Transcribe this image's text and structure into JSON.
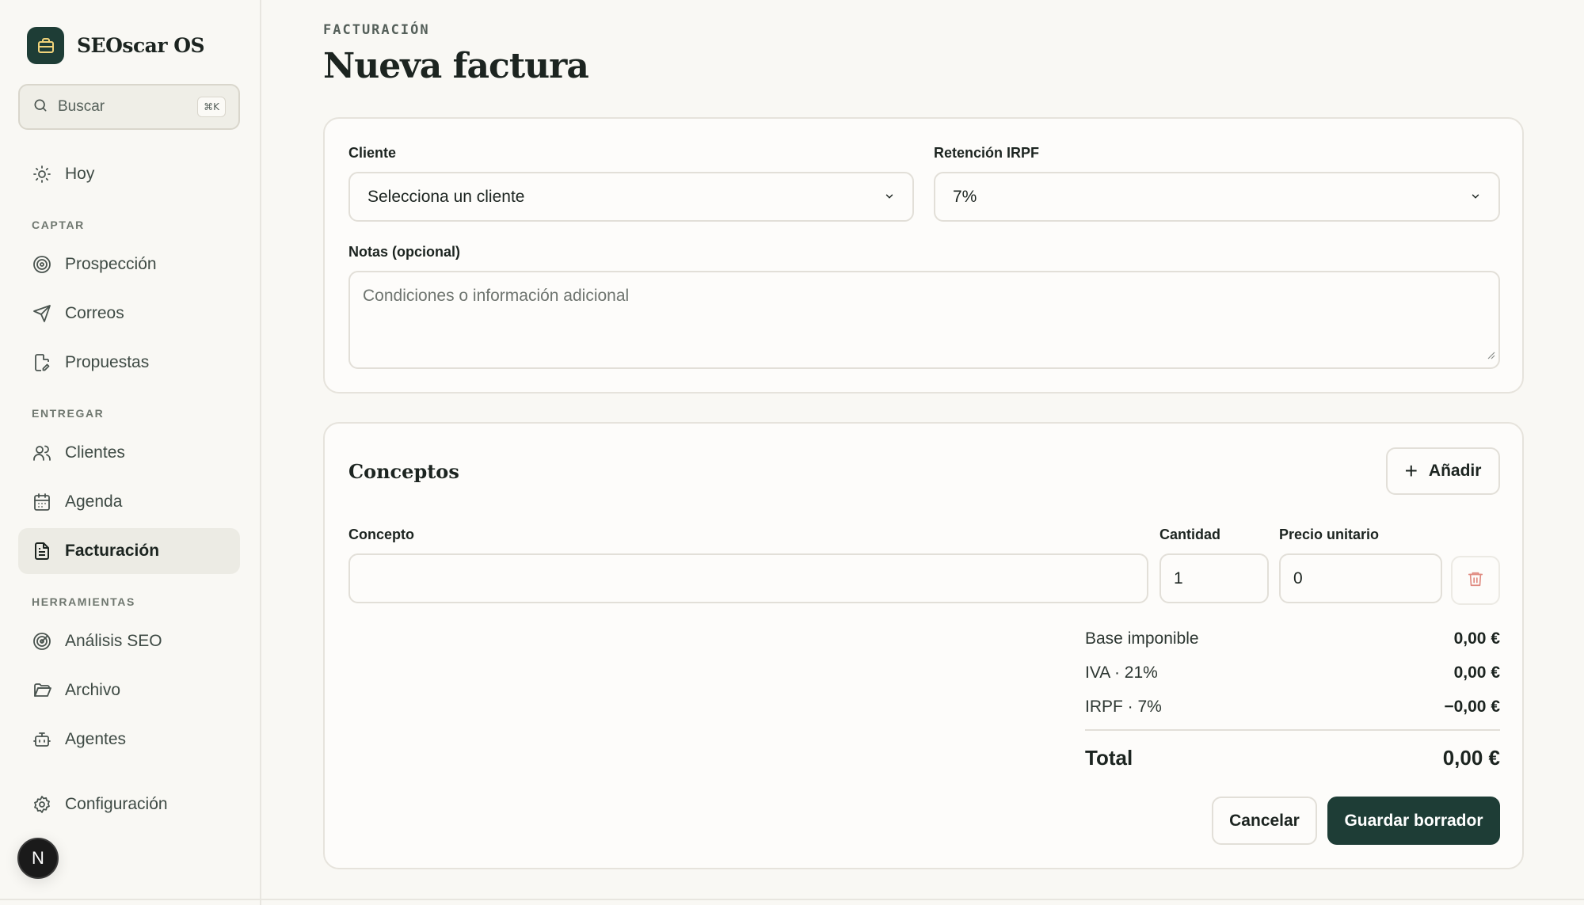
{
  "sidebar": {
    "brand": "SEOscar OS",
    "search_placeholder": "Buscar",
    "search_shortcut": "⌘K",
    "items": [
      {
        "label": "Hoy",
        "icon": "sun-icon"
      },
      {
        "label": "Prospección",
        "icon": "target-icon"
      },
      {
        "label": "Correos",
        "icon": "send-icon"
      },
      {
        "label": "Propuestas",
        "icon": "document-edit-icon"
      },
      {
        "label": "Clientes",
        "icon": "users-icon"
      },
      {
        "label": "Agenda",
        "icon": "calendar-icon"
      },
      {
        "label": "Facturación",
        "icon": "file-text-icon",
        "active": true
      },
      {
        "label": "Análisis SEO",
        "icon": "radar-icon"
      },
      {
        "label": "Archivo",
        "icon": "folder-icon"
      },
      {
        "label": "Agentes",
        "icon": "bot-icon"
      },
      {
        "label": "Configuración",
        "icon": "gear-icon"
      }
    ],
    "sections": [
      "CAPTAR",
      "ENTREGAR",
      "HERRAMIENTAS"
    ],
    "avatar_initial": "N"
  },
  "header": {
    "kicker": "FACTURACIÓN",
    "title": "Nueva factura"
  },
  "form": {
    "client_label": "Cliente",
    "client_value": "Selecciona un cliente",
    "irpf_label": "Retención IRPF",
    "irpf_value": "7%",
    "notes_label": "Notas (opcional)",
    "notes_placeholder": "Condiciones o información adicional"
  },
  "concepts": {
    "title": "Conceptos",
    "add_label": "Añadir",
    "col_concept": "Concepto",
    "col_quantity": "Cantidad",
    "col_unit_price": "Precio unitario",
    "rows": [
      {
        "concept": "",
        "quantity": "1",
        "unit_price": "0"
      }
    ]
  },
  "summary": {
    "base_label": "Base imponible",
    "base_value": "0,00 €",
    "iva_label": "IVA · 21%",
    "iva_value": "0,00 €",
    "irpf_label": "IRPF · 7%",
    "irpf_value": "−0,00 €",
    "total_label": "Total",
    "total_value": "0,00 €"
  },
  "actions": {
    "cancel_label": "Cancelar",
    "save_label": "Guardar borrador"
  },
  "colors": {
    "accent": "#1e3d36",
    "background": "#f9f8f4",
    "delete": "#e08a80"
  }
}
